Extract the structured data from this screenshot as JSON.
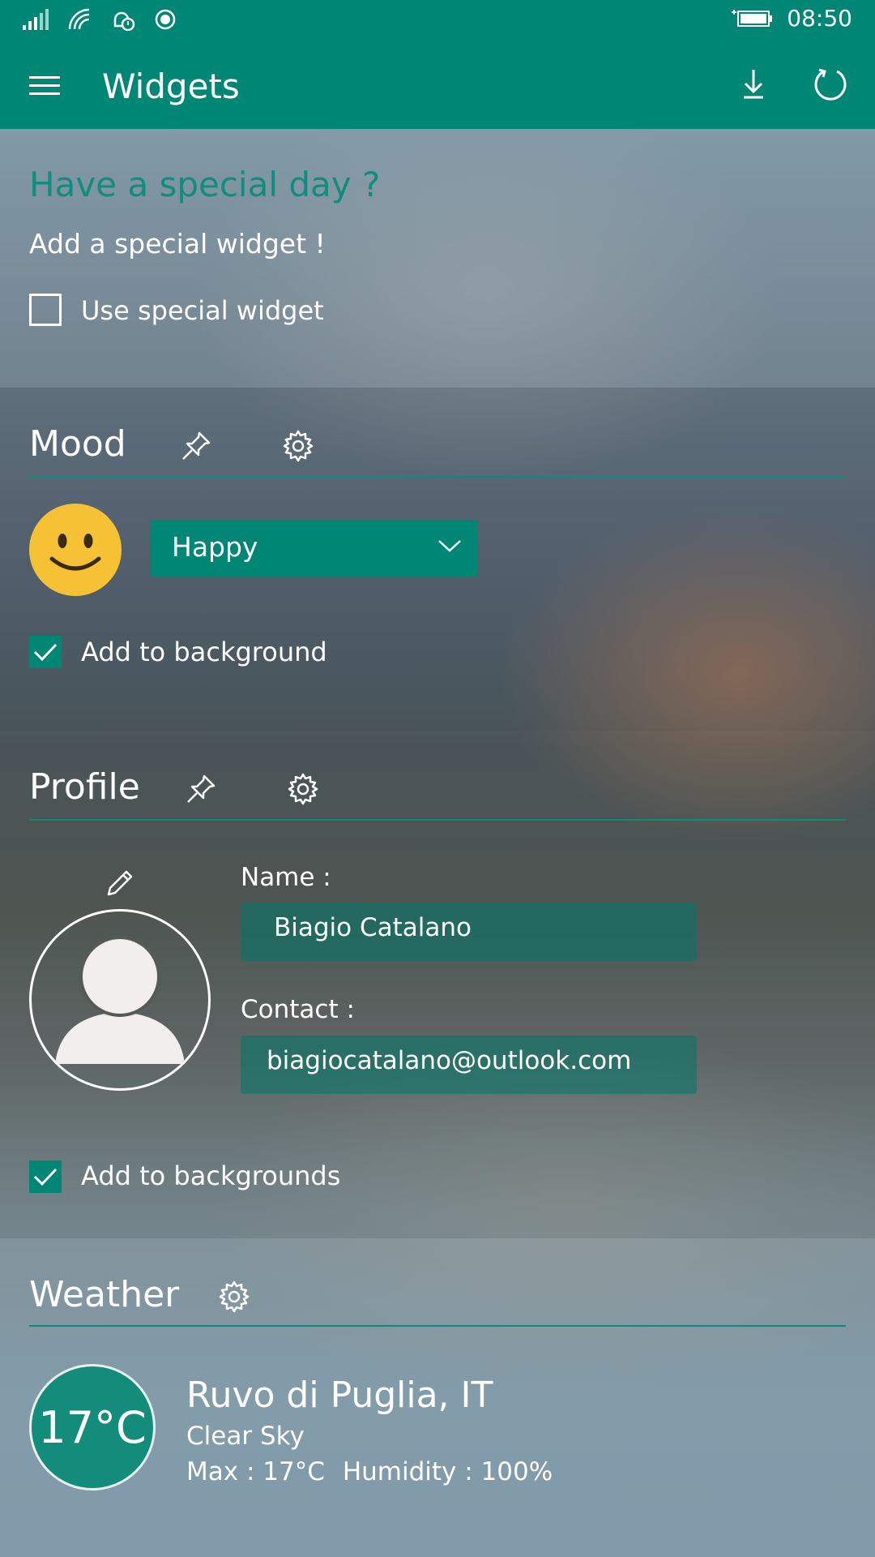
{
  "statusbar": {
    "time": "08:50"
  },
  "appbar": {
    "title": "Widgets"
  },
  "special": {
    "title": "Have a special day ?",
    "subtitle": "Add a special widget !",
    "checkbox_label": "Use special widget",
    "checked": false
  },
  "mood": {
    "title": "Mood",
    "selected": "Happy",
    "checkbox_label": "Add to background",
    "checked": true
  },
  "profile": {
    "title": "Profile",
    "name_label": "Name :",
    "name_value": "Biagio Catalano",
    "contact_label": "Contact :",
    "contact_value": "biagiocatalano@outlook.com",
    "checkbox_label": "Add to backgrounds",
    "checked": true
  },
  "weather": {
    "title": "Weather",
    "temperature": "17°C",
    "city": "Ruvo di Puglia, IT",
    "condition": "Clear Sky",
    "max": "Max : 17°C",
    "humidity": "Humidity : 100%"
  },
  "colors": {
    "accent": "#008674",
    "smiley": "#f5c236"
  }
}
